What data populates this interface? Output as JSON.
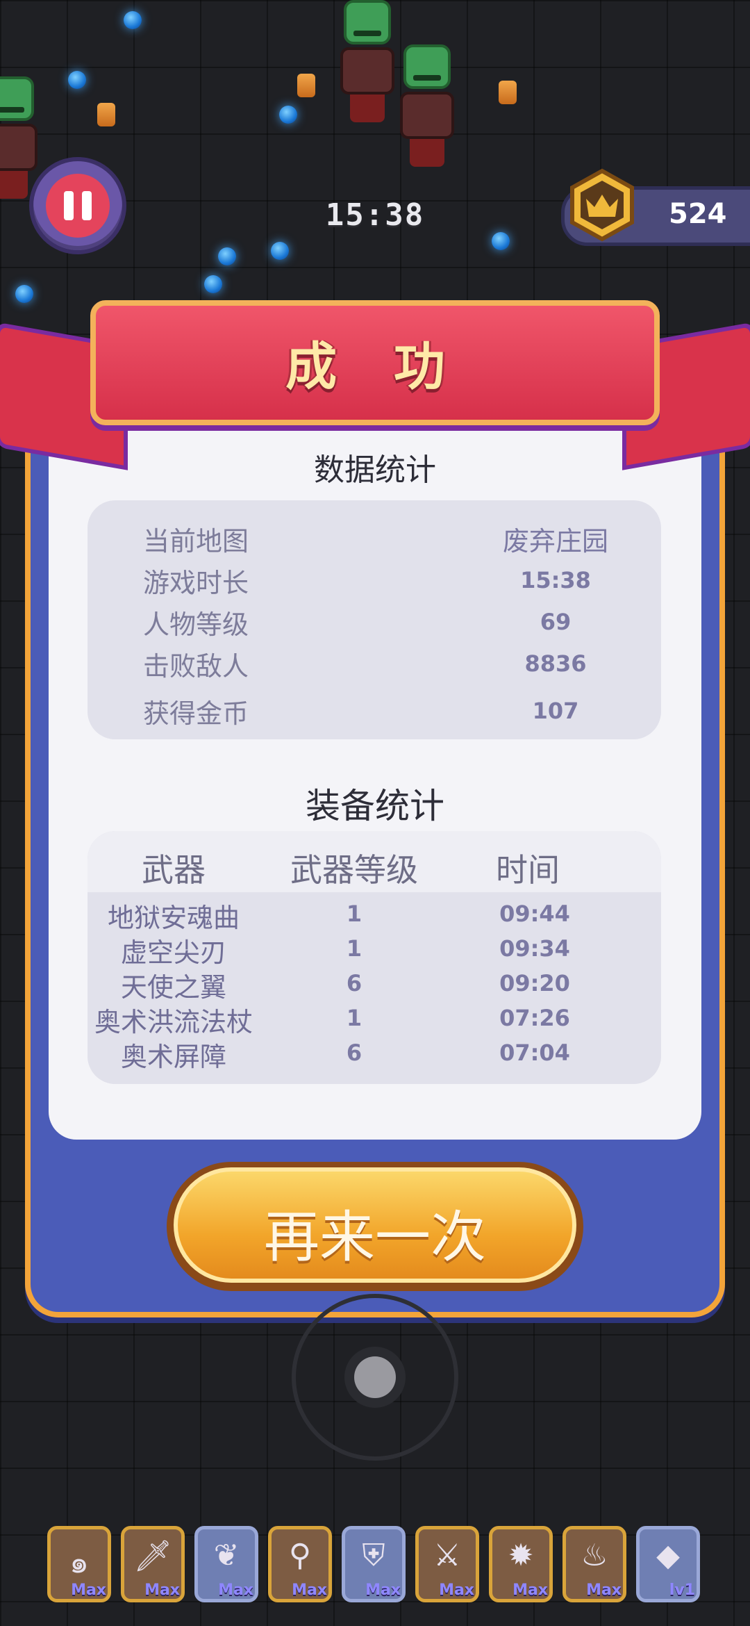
{
  "hud": {
    "timer": "15:38",
    "coins": "524"
  },
  "result": {
    "title": "成 功",
    "stats_title": "数据统计",
    "stats": [
      {
        "label": "当前地图",
        "value": "废弃庄园"
      },
      {
        "label": "游戏时长",
        "value": "15:38"
      },
      {
        "label": "人物等级",
        "value": "69"
      },
      {
        "label": "击败敌人",
        "value": "8836"
      },
      {
        "label": "获得金币",
        "value": "107"
      }
    ],
    "equip_title": "装备统计",
    "equip_headers": [
      "武器",
      "武器等级",
      "时间"
    ],
    "equip_rows": [
      {
        "name": "地狱安魂曲",
        "level": "1",
        "time": "09:44"
      },
      {
        "name": "虚空尖刃",
        "level": "1",
        "time": "09:34"
      },
      {
        "name": "天使之翼",
        "level": "6",
        "time": "09:20"
      },
      {
        "name": "奥术洪流法杖",
        "level": "1",
        "time": "07:26"
      },
      {
        "name": "奥术屏障",
        "level": "6",
        "time": "07:04"
      }
    ],
    "retry_label": "再来一次"
  },
  "skills": [
    {
      "icon": "spiral-rune-icon",
      "glyph": "๑",
      "level": "Max",
      "style": "gold"
    },
    {
      "icon": "dagger-icon",
      "glyph": "🗡",
      "level": "Max",
      "style": "gold"
    },
    {
      "icon": "wings-icon",
      "glyph": "❦",
      "level": "Max",
      "style": "blue"
    },
    {
      "icon": "magic-mirror-icon",
      "glyph": "⚲",
      "level": "Max",
      "style": "gold"
    },
    {
      "icon": "winged-shield-icon",
      "glyph": "⛨",
      "level": "Max",
      "style": "blue"
    },
    {
      "icon": "sword-icon",
      "glyph": "⚔",
      "level": "Max",
      "style": "gold"
    },
    {
      "icon": "blaster-icon",
      "glyph": "✹",
      "level": "Max",
      "style": "gold"
    },
    {
      "icon": "fire-staff-icon",
      "glyph": "♨",
      "level": "Max",
      "style": "gold"
    },
    {
      "icon": "crystal-icon",
      "glyph": "◆",
      "level": "lv1",
      "style": "blue"
    }
  ]
}
